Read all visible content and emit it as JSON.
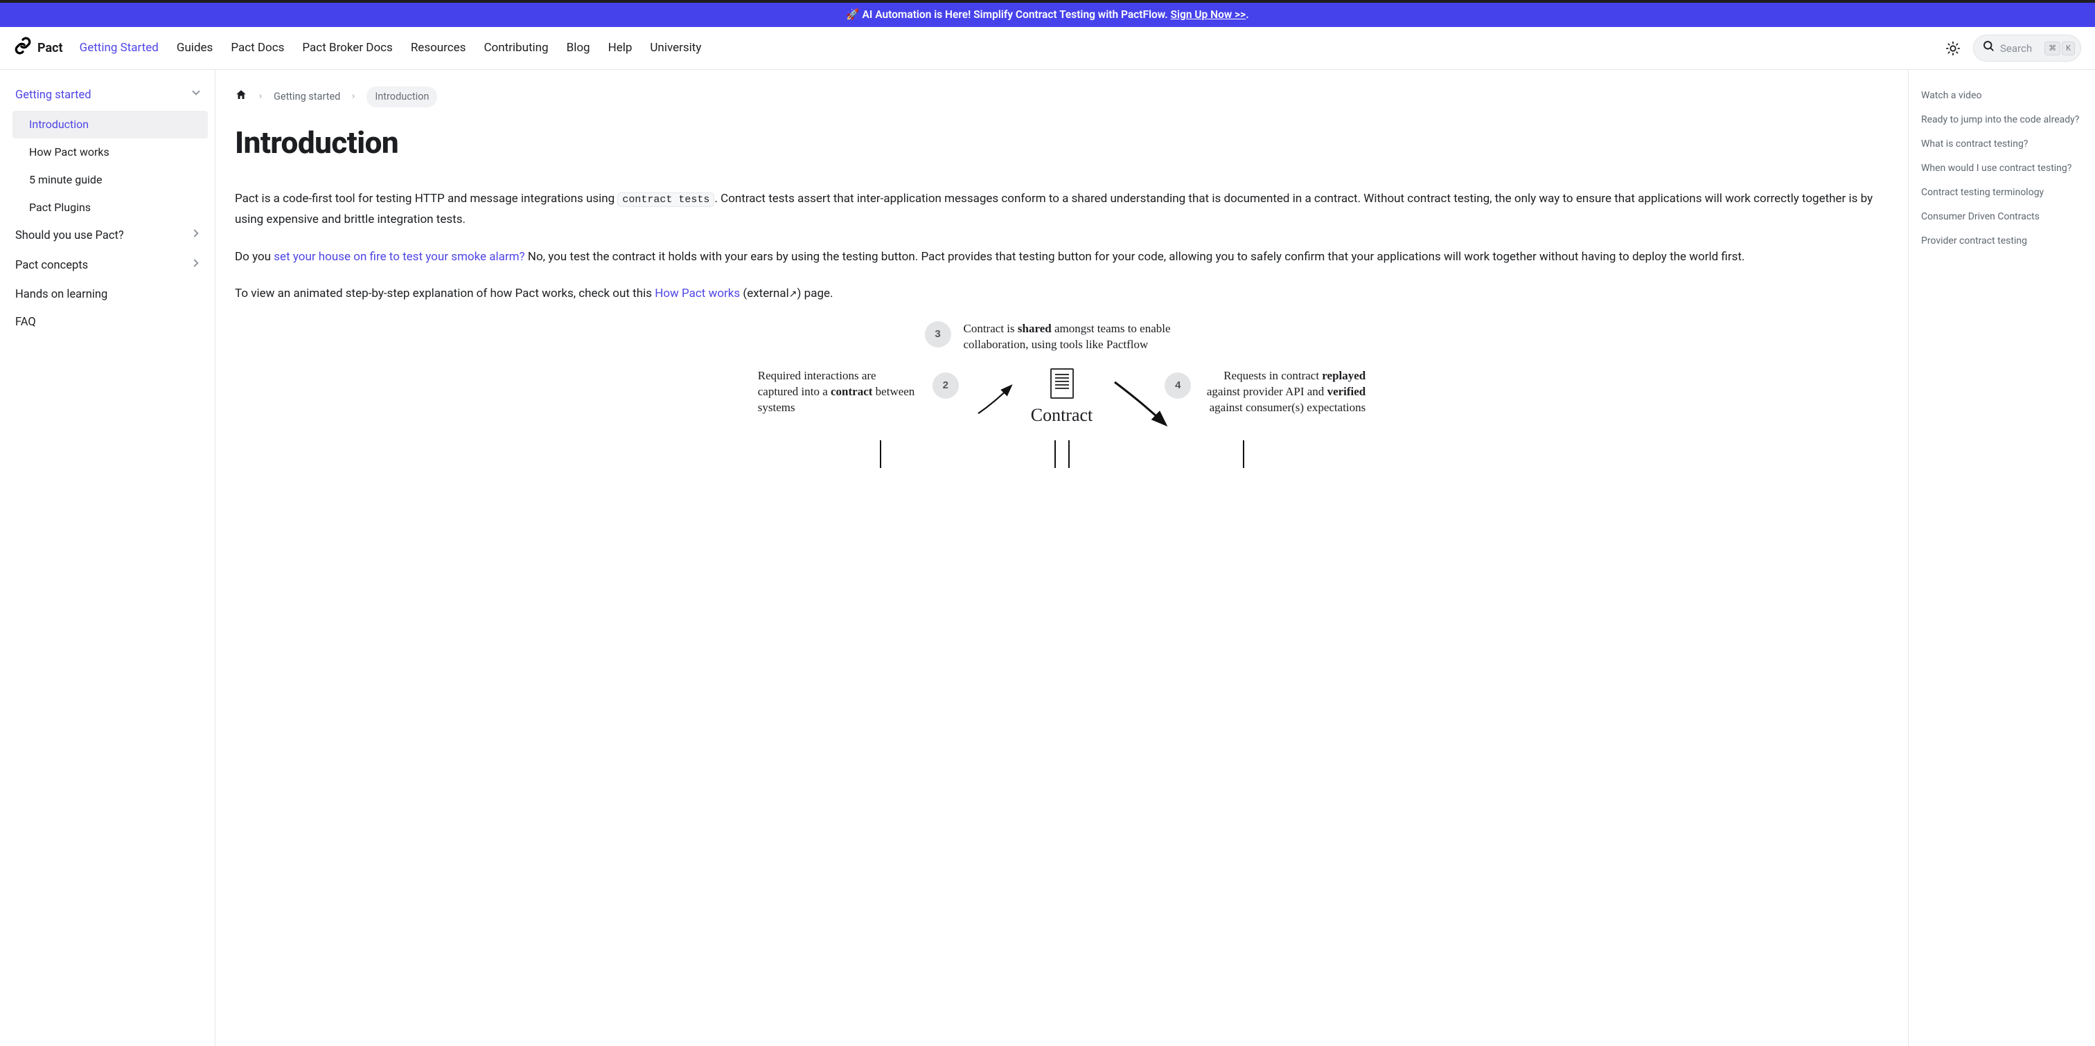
{
  "banner": {
    "emoji": "🚀",
    "text": "AI Automation is Here! Simplify Contract Testing with PactFlow.",
    "cta": "Sign Up Now >>",
    "trailing": "."
  },
  "brand": {
    "name": "Pact"
  },
  "nav": {
    "items": [
      {
        "label": "Getting Started",
        "active": true
      },
      {
        "label": "Guides"
      },
      {
        "label": "Pact Docs"
      },
      {
        "label": "Pact Broker Docs"
      },
      {
        "label": "Resources"
      },
      {
        "label": "Contributing"
      },
      {
        "label": "Blog"
      },
      {
        "label": "Help"
      },
      {
        "label": "University"
      }
    ]
  },
  "search": {
    "placeholder": "Search",
    "kbd1": "⌘",
    "kbd2": "K"
  },
  "sidebar": {
    "sections": [
      {
        "label": "Getting started",
        "expanded": true,
        "activeParent": true,
        "children": [
          {
            "label": "Introduction",
            "active": true
          },
          {
            "label": "How Pact works"
          },
          {
            "label": "5 minute guide"
          },
          {
            "label": "Pact Plugins"
          }
        ]
      },
      {
        "label": "Should you use Pact?",
        "chevron": true
      },
      {
        "label": "Pact concepts",
        "chevron": true
      },
      {
        "label": "Hands on learning"
      },
      {
        "label": "FAQ"
      }
    ]
  },
  "breadcrumbs": {
    "home_icon": "home",
    "items": [
      {
        "label": "Getting started"
      },
      {
        "label": "Introduction",
        "current": true
      }
    ]
  },
  "page": {
    "title": "Introduction",
    "p1_a": "Pact is a code-first tool for testing HTTP and message integrations using ",
    "p1_code": "contract tests",
    "p1_b": ". Contract tests assert that inter-application messages conform to a shared understanding that is documented in a contract. Without contract testing, the only way to ensure that applications will work correctly together is by using expensive and brittle integration tests.",
    "p2_a": "Do you ",
    "p2_link": "set your house on fire to test your smoke alarm?",
    "p2_b": " No, you test the contract it holds with your ears by using the testing button. Pact provides that testing button for your code, allowing you to safely confirm that your applications will work together without having to deploy the world first.",
    "p3_a": "To view an animated step-by-step explanation of how Pact works, check out this ",
    "p3_link": "How Pact works",
    "p3_b": " (external",
    "p3_ext_icon": "↗",
    "p3_c": ") page."
  },
  "diagram": {
    "step3_num": "3",
    "step3_a": "Contract is ",
    "step3_bold": "shared",
    "step3_b": " amongst teams to enable collaboration, using tools like Pactflow",
    "step2_num": "2",
    "left_a": "Required interactions are captured into a ",
    "left_bold": "contract",
    "left_b": " between systems",
    "contract_label": "Contract",
    "step4_num": "4",
    "right_a": "Requests in contract ",
    "right_bold1": "replayed",
    "right_b": " against provider API and ",
    "right_bold2": "verified",
    "right_c": " against consumer(s) expectations"
  },
  "toc": {
    "items": [
      "Watch a video",
      "Ready to jump into the code already?",
      "What is contract testing?",
      "When would I use contract testing?",
      "Contract testing terminology",
      "Consumer Driven Contracts",
      "Provider contract testing"
    ]
  }
}
